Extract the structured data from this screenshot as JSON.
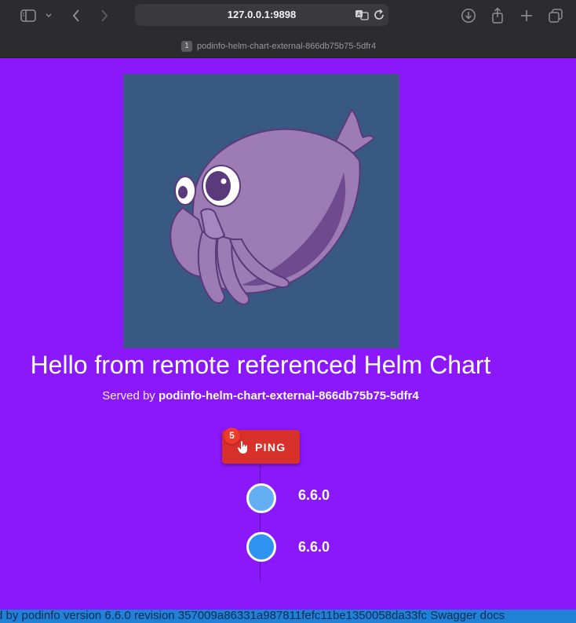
{
  "browser": {
    "url": "127.0.0.1:9898",
    "tab_number": "1",
    "tab_title": "podinfo-helm-chart-external-866db75b75-5dfr4"
  },
  "page": {
    "heading": "Hello from remote referenced Helm Chart",
    "served_prefix": "Served by",
    "served_host": "podinfo-helm-chart-external-866db75b75-5dfr4",
    "ping": {
      "label": "PING",
      "badge": "5"
    },
    "timeline": [
      {
        "version": "6.6.0",
        "color": "#64aff3"
      },
      {
        "version": "6.6.0",
        "color": "#2f93f1"
      }
    ],
    "footer_text": "d by podinfo version 6.6.0 revision 357009a86331a987811fefc11be1350058da33fc Swagger docs"
  },
  "colors": {
    "background": "#8b18fb",
    "ping_button": "#d8302a",
    "footer": "#1f82d6",
    "logo_bg": "#395985"
  },
  "icons": [
    "sidebar-icon",
    "chevron-down-icon",
    "back-icon",
    "forward-icon",
    "translate-icon",
    "reload-icon",
    "download-icon",
    "share-icon",
    "new-tab-icon",
    "tabs-overview-icon",
    "pointer-hand-icon"
  ]
}
